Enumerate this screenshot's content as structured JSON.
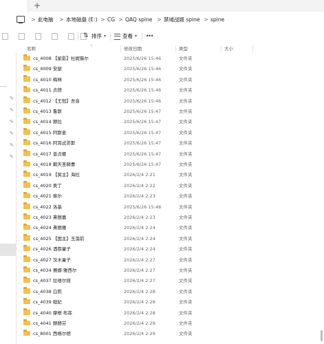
{
  "tabbar": {
    "new_tab_label": "+"
  },
  "breadcrumb": [
    "此电脑",
    "本地磁盘 (E:)",
    "CG",
    "QAQ spine",
    "禁域战姬 spine",
    "spine"
  ],
  "breadcrumb_separator": ">",
  "toolbar": {
    "sort_label": "排序",
    "view_label": "查看",
    "more_label": "•••"
  },
  "columns": {
    "name": "名称",
    "date": "修改日期",
    "type": "类型",
    "size": "大小"
  },
  "rows": [
    {
      "name": "cs_4008 【星影】杜妮薇尔",
      "date": "2025/6/26 15:46",
      "type": "文件夹"
    },
    {
      "name": "cs_4009 安瑟",
      "date": "2025/6/26 15:46",
      "type": "文件夹"
    },
    {
      "name": "cs_4010 梅林",
      "date": "2025/6/26 15:46",
      "type": "文件夹"
    },
    {
      "name": "cs_4011 贞德",
      "date": "2025/6/26 15:46",
      "type": "文件夹"
    },
    {
      "name": "cs_4012 【王冠】吾音",
      "date": "2025/6/26 15:46",
      "type": "文件夹"
    },
    {
      "name": "cs_4013 鲁斯",
      "date": "2025/6/26 15:47",
      "type": "文件夹"
    },
    {
      "name": "cs_4014 赫拉",
      "date": "2025/6/26 15:47",
      "type": "文件夹"
    },
    {
      "name": "cs_4015 阿斯麦",
      "date": "2025/6/26 15:47",
      "type": "文件夹"
    },
    {
      "name": "cs_4016 阿耳忒弥斯",
      "date": "2025/6/26 15:47",
      "type": "文件夹"
    },
    {
      "name": "cs_4017 普贞娜",
      "date": "2025/6/26 15:47",
      "type": "文件夹"
    },
    {
      "name": "cs_4018 朝天圣騎曹",
      "date": "2025/6/26 15:47",
      "type": "文件夹"
    },
    {
      "name": "cs_4019 【冥主】海拉",
      "date": "2026/2/4 2:21",
      "type": "文件夹"
    },
    {
      "name": "cs_4020 奥丁",
      "date": "2026/2/4 2:22",
      "type": "文件夹"
    },
    {
      "name": "cs_4021 索尔",
      "date": "2026/2/4 2:23",
      "type": "文件夹"
    },
    {
      "name": "cs_4022 洛基",
      "date": "2025/6/26 15:48",
      "type": "文件夹"
    },
    {
      "name": "cs_4023 弗丽嘉",
      "date": "2026/2/4 2:23",
      "type": "文件夹"
    },
    {
      "name": "cs_4024 弗丽雅",
      "date": "2026/2/4 2:24",
      "type": "文件夹"
    },
    {
      "name": "cs_4025 【国主】玉藻前",
      "date": "2026/2/4 2:24",
      "type": "文件夹"
    },
    {
      "name": "cs_4026 酒吞童子",
      "date": "2026/2/4 2:24",
      "type": "文件夹"
    },
    {
      "name": "cs_4027 茨木童子",
      "date": "2026/2/4 2:27",
      "type": "文件夹"
    },
    {
      "name": "cs_4034 赛娜·雅西尔",
      "date": "2026/2/4 2:27",
      "type": "文件夹"
    },
    {
      "name": "cs_4037 拉维尔娅",
      "date": "2026/2/4 2:27",
      "type": "文件夹"
    },
    {
      "name": "cs_4038 白莉",
      "date": "2026/2/4 2:28",
      "type": "文件夹"
    },
    {
      "name": "cs_4039 妲妃",
      "date": "2026/2/4 2:28",
      "type": "文件夹"
    },
    {
      "name": "cs_4040 摩根·布菲",
      "date": "2026/2/4 2:28",
      "type": "文件夹"
    },
    {
      "name": "cs_4041 赫赫芬",
      "date": "2026/2/4 2:29",
      "type": "文件夹"
    },
    {
      "name": "cs_8001 西格尔德",
      "date": "2026/2/4 2:29",
      "type": "文件夹"
    }
  ]
}
